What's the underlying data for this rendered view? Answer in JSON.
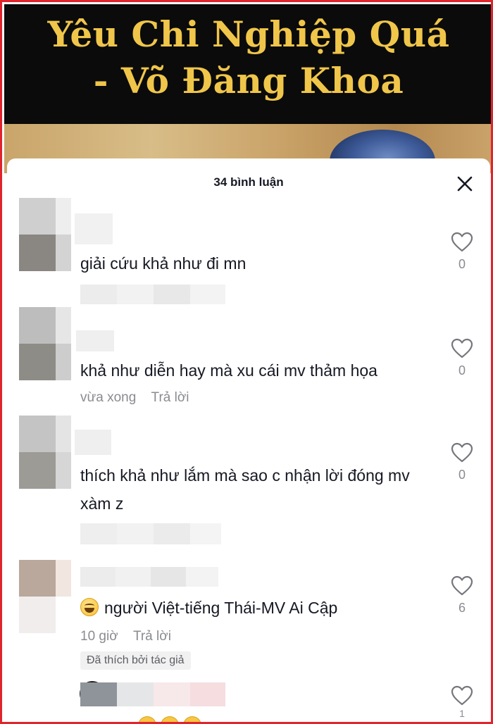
{
  "banner": {
    "title_line1": "Yêu Chi Nghiệp Quá",
    "title_line2": "- Võ Đăng Khoa"
  },
  "sheet": {
    "comment_count": "34 bình luận",
    "close_icon": "close-icon"
  },
  "comments": [
    {
      "text": "giải cứu khả như đi mn",
      "time": "",
      "reply": "",
      "likes": "0"
    },
    {
      "text": "khả như diễn hay mà xu cái mv thảm họa",
      "time": "vừa xong",
      "reply": "Trả lời",
      "likes": "0"
    },
    {
      "text": "thích khả như lắm mà sao c nhận lời đóng mv xàm z",
      "time": "",
      "reply": "",
      "likes": "0"
    },
    {
      "text": "người Việt-tiếng Thái-MV Ai Cập",
      "emoji": "grinning-squinting-face-emoji",
      "time": "10 giờ",
      "reply": "Trả lời",
      "badge": "Đã thích bởi tác giả",
      "likes": "6"
    },
    {
      "text": "",
      "time": "",
      "reply": "",
      "likes": "1"
    }
  ],
  "colors": {
    "frame_border": "#e0242c",
    "banner_title": "#f0c64a",
    "text_primary": "#161823",
    "text_secondary": "#8a8b91"
  }
}
